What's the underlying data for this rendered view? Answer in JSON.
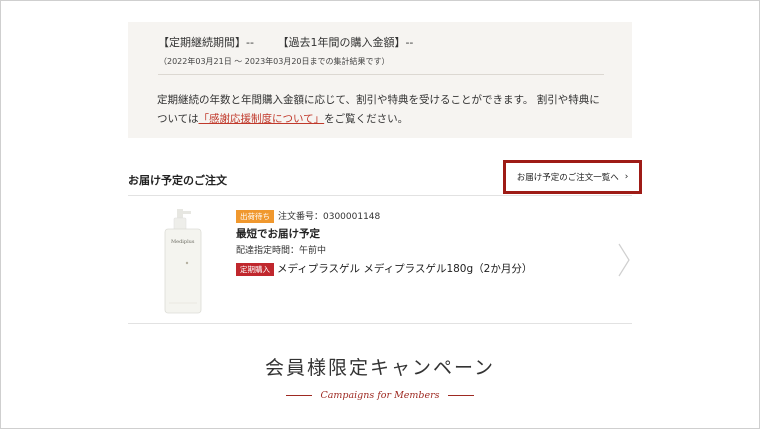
{
  "info": {
    "continuation_label": "【定期継続期間】--",
    "purchase_label": "【過去1年間の購入金額】--",
    "range_note": "（2022年03月21日 ～ 2023年03月20日までの集計結果です）",
    "desc_part1": "定期継続の年数と年間購入金額に応じて、割引や特典を受けることができます。 割引や特典については",
    "desc_link": "「感謝応援制度について」",
    "desc_part2": "をご覧ください。"
  },
  "section": {
    "title": "お届け予定のご注文",
    "list_link": "お届け予定のご注文一覧へ",
    "list_chevron": "›"
  },
  "order": {
    "status_badge": "出荷待ち",
    "order_no_label": "注文番号：0300001148",
    "delivery_title": "最短でお届け予定",
    "time_spec": "配達指定時間：午前中",
    "type_badge": "定期購入",
    "product_name": "メディプラスゲル メディプラスゲル180g（2か月分）",
    "bottle_label": "Mediplus"
  },
  "campaign": {
    "title": "会員様限定キャンペーン",
    "subtitle": "Campaigns for Members"
  },
  "colors": {
    "accent_red": "#9e1b16",
    "link_red": "#c0392b",
    "ship_badge": "#f0982e",
    "regular_badge": "#c0272d",
    "info_bg": "#f6f4f1"
  }
}
